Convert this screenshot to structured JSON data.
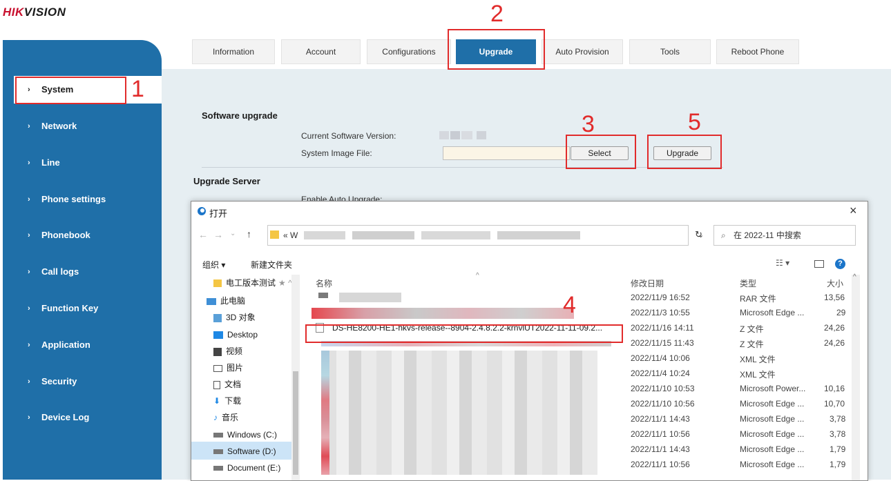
{
  "brand": {
    "logo_text_red": "HIK",
    "logo_text_dark": "VISION"
  },
  "colors": {
    "sidebar": "#1f6fa8",
    "accent": "#1f6fa8",
    "annotation": "#e12b2b",
    "content_bg": "#e6eef2"
  },
  "tabs": [
    {
      "label": "Information"
    },
    {
      "label": "Account"
    },
    {
      "label": "Configurations"
    },
    {
      "label": "Upgrade",
      "active": true
    },
    {
      "label": "Auto Provision"
    },
    {
      "label": "Tools"
    },
    {
      "label": "Reboot Phone"
    }
  ],
  "sidebar": {
    "items": [
      {
        "label": "System",
        "active": true
      },
      {
        "label": "Network"
      },
      {
        "label": "Line"
      },
      {
        "label": "Phone settings"
      },
      {
        "label": "Phonebook"
      },
      {
        "label": "Call logs"
      },
      {
        "label": "Function Key"
      },
      {
        "label": "Application"
      },
      {
        "label": "Security"
      },
      {
        "label": "Device Log"
      }
    ],
    "chevron": "›"
  },
  "upgrade": {
    "software_title": "Software upgrade",
    "current_version_label": "Current Software Version:",
    "image_file_label": "System Image File:",
    "select_button": "Select",
    "upgrade_button": "Upgrade",
    "server_title": "Upgrade Server",
    "auto_upgrade_label": "Enable Auto Upgrade:"
  },
  "annotations": [
    "1",
    "2",
    "3",
    "4",
    "5"
  ],
  "dialog": {
    "title": "打开",
    "close": "×",
    "address_prefix": "« W",
    "search_placeholder": "在 2022-11 中搜索",
    "toolbar_organize": "组织 ▾",
    "toolbar_new_folder": "新建文件夹",
    "nav_items": [
      {
        "label": "电工版本测试",
        "icon": "folder-icon"
      },
      {
        "label": "此电脑",
        "icon": "computer-icon"
      },
      {
        "label": "3D 对象",
        "icon": "cube-icon"
      },
      {
        "label": "Desktop",
        "icon": "desktop-icon"
      },
      {
        "label": "视频",
        "icon": "video-icon"
      },
      {
        "label": "图片",
        "icon": "picture-icon"
      },
      {
        "label": "文档",
        "icon": "document-icon"
      },
      {
        "label": "下载",
        "icon": "download-icon"
      },
      {
        "label": "音乐",
        "icon": "music-icon"
      },
      {
        "label": "Windows (C:)",
        "icon": "drive-icon"
      },
      {
        "label": "Software (D:)",
        "icon": "drive-icon"
      },
      {
        "label": "Document (E:)",
        "icon": "drive-icon"
      }
    ],
    "columns": {
      "name": "名称",
      "date": "修改日期",
      "type": "类型",
      "size": "大小"
    },
    "highlight_file": "DS-HE8200-HE1-hkvs-release--8904-2.4.8.2.2-krnvlUT2022-11-11-09.2...",
    "rows": [
      {
        "date": "2022/11/9 16:52",
        "type": "RAR 文件",
        "size": "13,56"
      },
      {
        "date": "2022/11/3 10:55",
        "type": "Microsoft Edge ...",
        "size": "29"
      },
      {
        "date": "2022/11/16 14:11",
        "type": "Z 文件",
        "size": "24,26"
      },
      {
        "date": "2022/11/15 11:43",
        "type": "Z 文件",
        "size": "24,26"
      },
      {
        "date": "2022/11/4 10:06",
        "type": "XML 文件",
        "size": ""
      },
      {
        "date": "2022/11/4 10:24",
        "type": "XML 文件",
        "size": ""
      },
      {
        "date": "2022/11/10 10:53",
        "type": "Microsoft Power...",
        "size": "10,16"
      },
      {
        "date": "2022/11/10 10:56",
        "type": "Microsoft Edge ...",
        "size": "10,70"
      },
      {
        "date": "2022/11/1 14:43",
        "type": "Microsoft Edge ...",
        "size": "3,78"
      },
      {
        "date": "2022/11/1 10:56",
        "type": "Microsoft Edge ...",
        "size": "3,78"
      },
      {
        "date": "2022/11/1 14:43",
        "type": "Microsoft Edge ...",
        "size": "1,79"
      },
      {
        "date": "2022/11/1 10:56",
        "type": "Microsoft Edge ...",
        "size": "1,79"
      }
    ]
  }
}
